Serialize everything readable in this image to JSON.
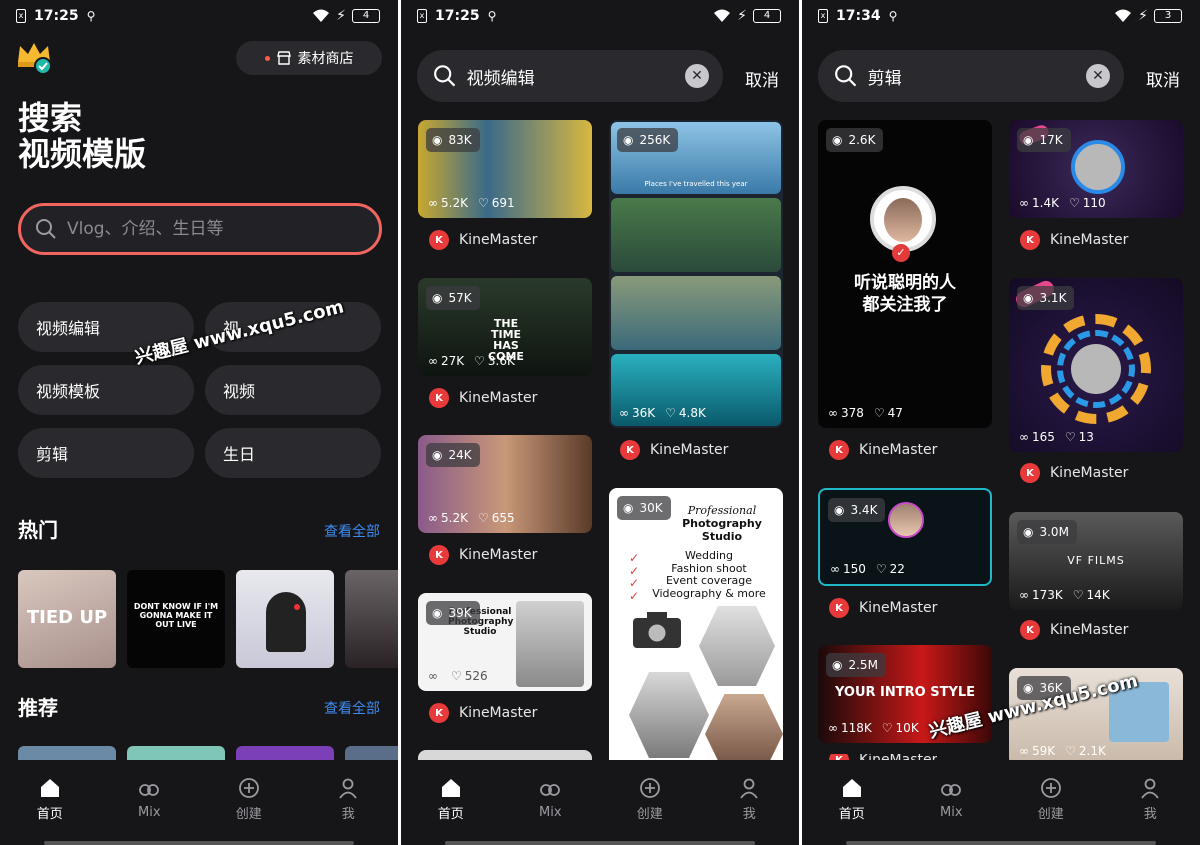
{
  "nav": [
    {
      "label": "首页",
      "icon": "home-icon"
    },
    {
      "label": "Mix",
      "icon": "mix-icon"
    },
    {
      "label": "创建",
      "icon": "create-icon"
    },
    {
      "label": "我",
      "icon": "profile-icon"
    }
  ],
  "panel1": {
    "status": {
      "time": "17:25",
      "battery": "4"
    },
    "store_label": "素材商店",
    "title_line1": "搜索",
    "title_line2": "视频模版",
    "search_placeholder": "Vlog、介绍、生日等",
    "chips": [
      "视频编辑",
      "视",
      "视频模板",
      "视频",
      "剪辑",
      "生日"
    ],
    "hot_title": "热门",
    "recommend_title": "推荐",
    "see_all": "查看全部",
    "hot_captions": [
      "TIED UP",
      "DONT KNOW IF I'M GONNA MAKE IT OUT LIVE"
    ]
  },
  "panel2": {
    "status": {
      "time": "17:25",
      "battery": "4"
    },
    "query": "视频编辑",
    "cancel": "取消",
    "cards": [
      {
        "views": "83K",
        "uses": "5.2K",
        "likes": "691",
        "author": "KineMaster"
      },
      {
        "views": "57K",
        "uses": "27K",
        "likes": "3.6K",
        "author": "KineMaster",
        "caption": "THE TIME HAS COME"
      },
      {
        "views": "24K",
        "uses": "5.2K",
        "likes": "655",
        "author": "KineMaster"
      },
      {
        "views": "39K",
        "uses": "",
        "likes": "526",
        "author": "KineMaster",
        "caption": "Professional Photography Studio"
      },
      {
        "views": "256K",
        "uses": "36K",
        "likes": "4.8K",
        "author": "KineMaster",
        "caption": "Places I've travelled this year"
      },
      {
        "views": "30K",
        "author": "",
        "lines": [
          "Professional",
          "Photography",
          "Studio",
          "Wedding",
          "Fashion shoot",
          "Event coverage",
          "Videography & more"
        ]
      }
    ]
  },
  "panel3": {
    "status": {
      "time": "17:34",
      "battery": "3"
    },
    "query": "剪辑",
    "cancel": "取消",
    "cards": [
      {
        "views": "2.6K",
        "uses": "378",
        "likes": "47",
        "author": "KineMaster",
        "caption_line1": "听说聪明的人",
        "caption_line2": "都关注我了"
      },
      {
        "views": "3.4K",
        "uses": "150",
        "likes": "22",
        "author": "KineMaster"
      },
      {
        "views": "2.5M",
        "uses": "118K",
        "likes": "10K",
        "author": "KineMaster",
        "caption": "YOUR INTRO STYLE"
      },
      {
        "views": "17K",
        "uses": "1.4K",
        "likes": "110",
        "author": "KineMaster"
      },
      {
        "views": "3.1K",
        "uses": "165",
        "likes": "13",
        "author": "KineMaster"
      },
      {
        "views": "3.0M",
        "uses": "173K",
        "likes": "14K",
        "author": "KineMaster",
        "caption": "VF FILMS"
      },
      {
        "views": "36K",
        "uses": "59K",
        "likes": "2.1K",
        "author": ""
      }
    ]
  },
  "watermark": "兴趣屋 www.xqu5.com"
}
